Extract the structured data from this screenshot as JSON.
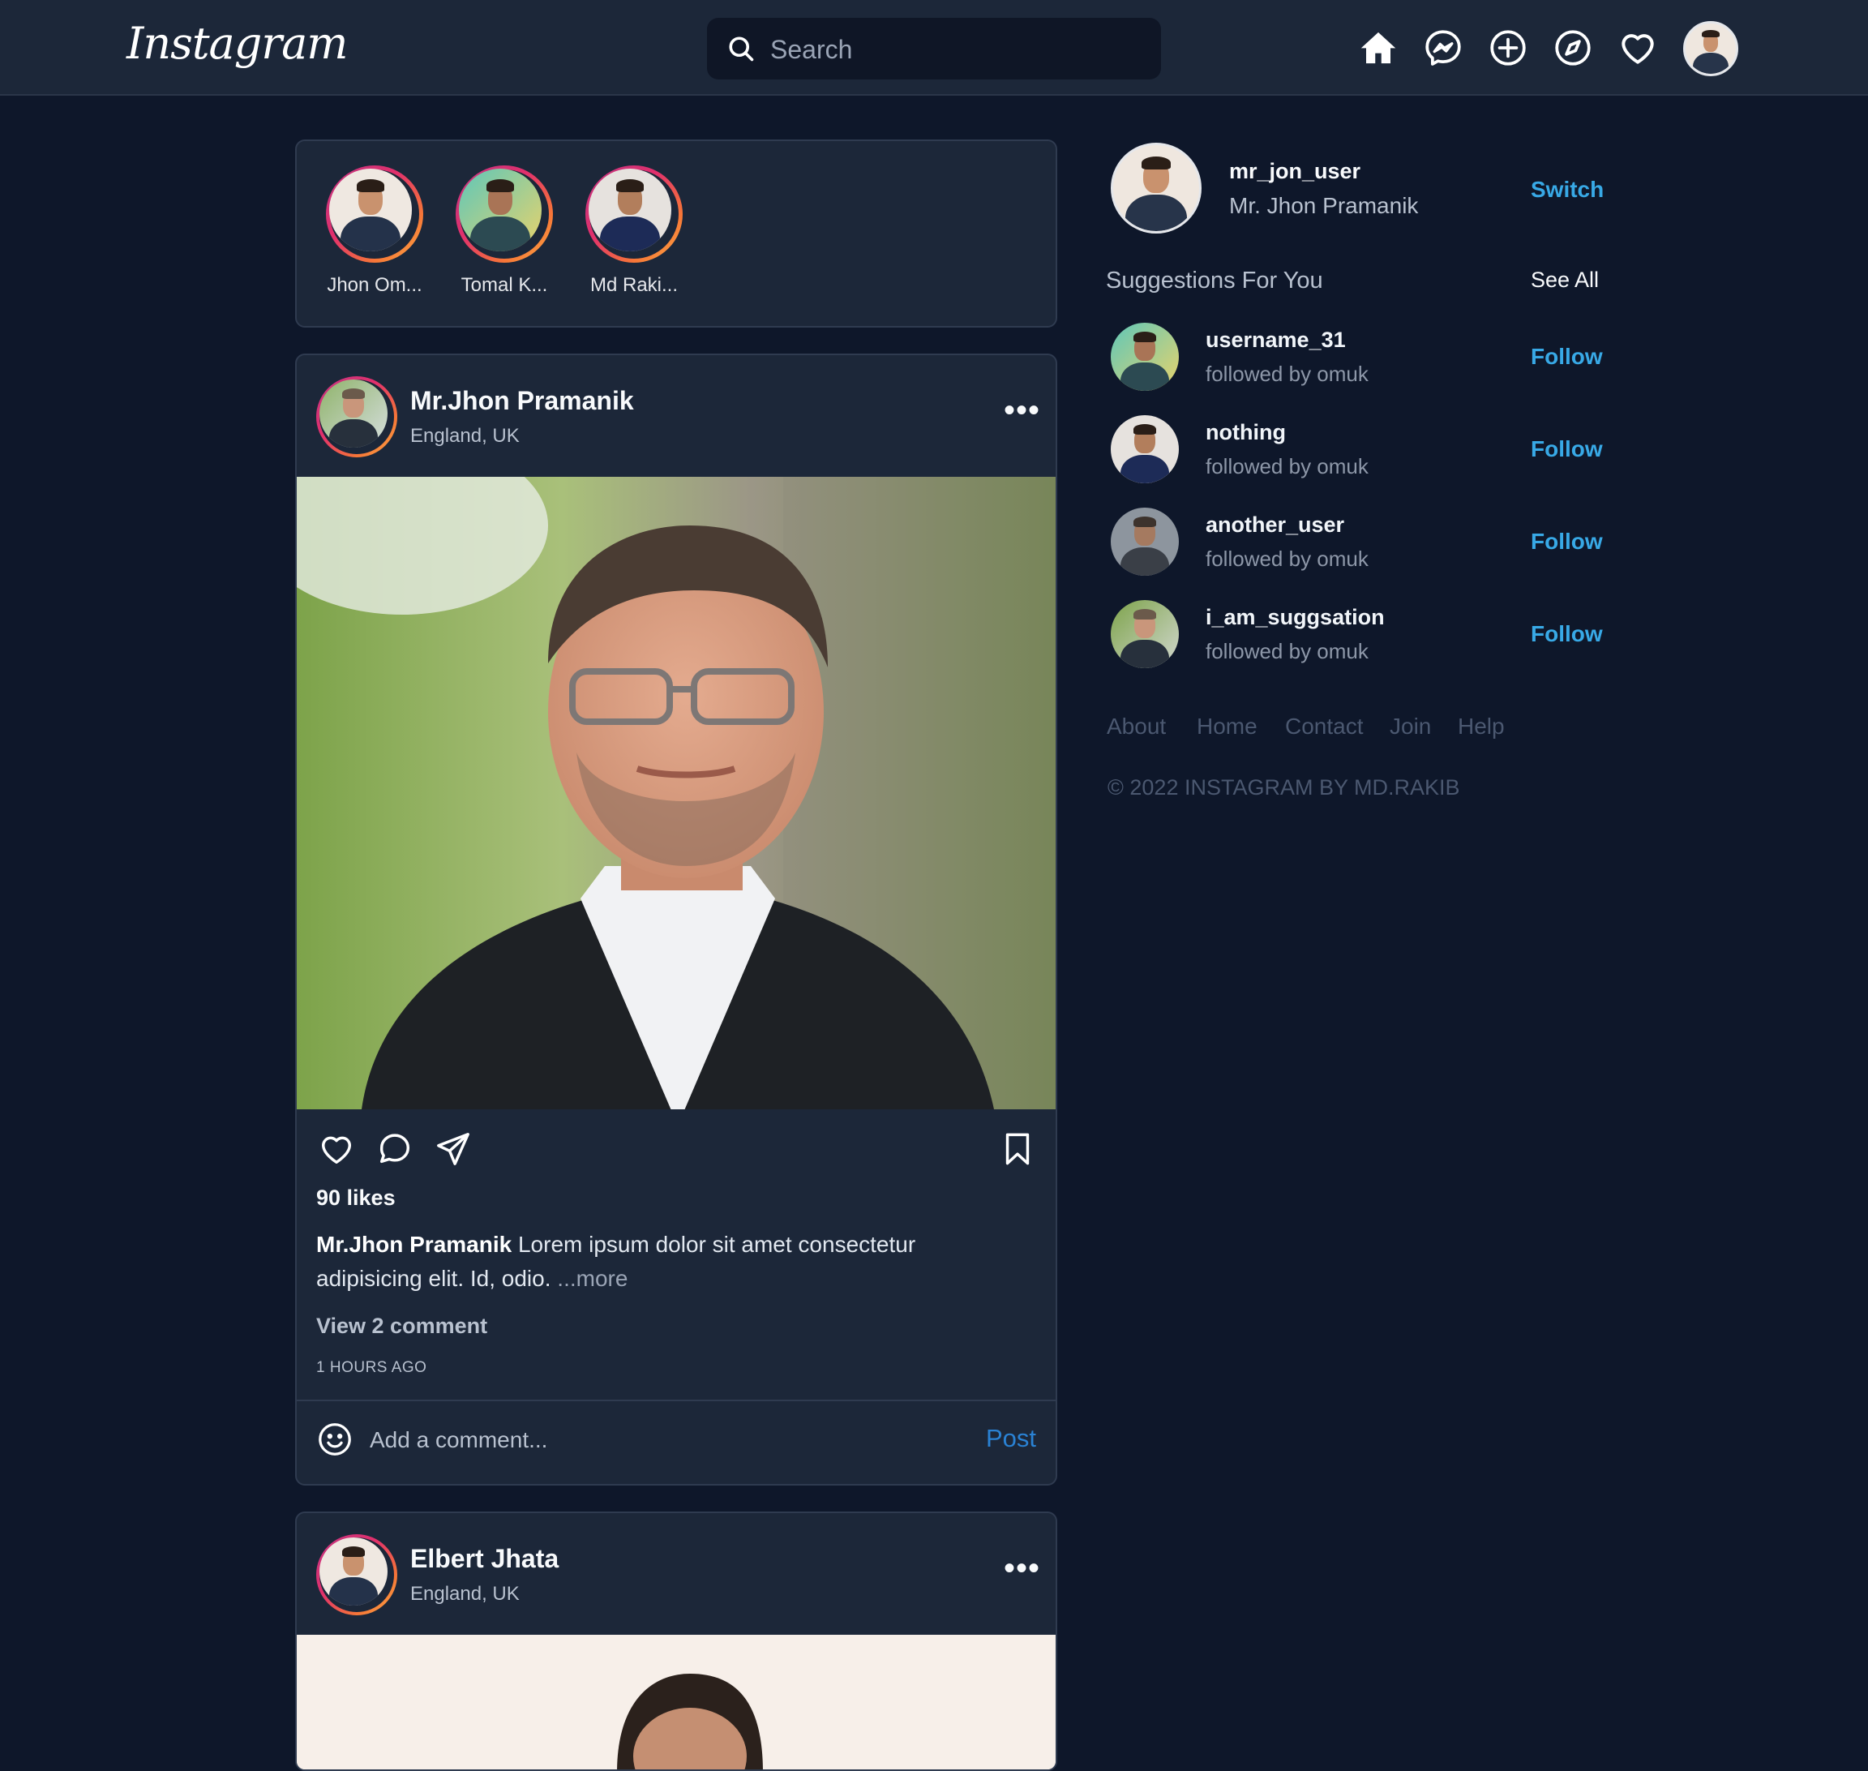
{
  "header": {
    "logo": "Instagram",
    "search_placeholder": "Search",
    "nav_icons": [
      "home-icon",
      "messenger-icon",
      "add-post-icon",
      "explore-icon",
      "heart-icon"
    ]
  },
  "stories": [
    {
      "name": "Jhon Om..."
    },
    {
      "name": "Tomal K..."
    },
    {
      "name": "Md Raki..."
    }
  ],
  "posts": [
    {
      "author": "Mr.Jhon Pramanik",
      "location": "England, UK",
      "likes": "90 likes",
      "caption_author": "Mr.Jhon Pramanik",
      "caption_text": "Lorem ipsum dolor sit amet consectetur adipisicing elit. Id, odio.",
      "more": "...more",
      "view_comments": "View 2 comment",
      "time": "1 HOURS AGO",
      "comment_placeholder": "Add a comment...",
      "post_label": "Post"
    },
    {
      "author": "Elbert Jhata",
      "location": "England, UK"
    }
  ],
  "profile": {
    "username": "mr_jon_user",
    "full_name": "Mr. Jhon Pramanik",
    "switch_label": "Switch"
  },
  "suggestions": {
    "title": "Suggestions For You",
    "see_all": "See All",
    "items": [
      {
        "username": "username_31",
        "sub": "followed by omuk",
        "action": "Follow"
      },
      {
        "username": "nothing",
        "sub": "followed by omuk",
        "action": "Follow"
      },
      {
        "username": "another_user",
        "sub": "followed by omuk",
        "action": "Follow"
      },
      {
        "username": "i_am_suggsation",
        "sub": "followed by omuk",
        "action": "Follow"
      }
    ]
  },
  "footer": {
    "links": [
      "About",
      "Home",
      "Contact",
      "Join",
      "Help"
    ],
    "copyright": "© 2022 INSTAGRAM BY MD.RAKIB"
  },
  "colors": {
    "page_bg": "#0e172a",
    "panel_bg": "#1c2739",
    "accent_blue": "#38a9e6",
    "post_blue": "#2a82d4"
  }
}
